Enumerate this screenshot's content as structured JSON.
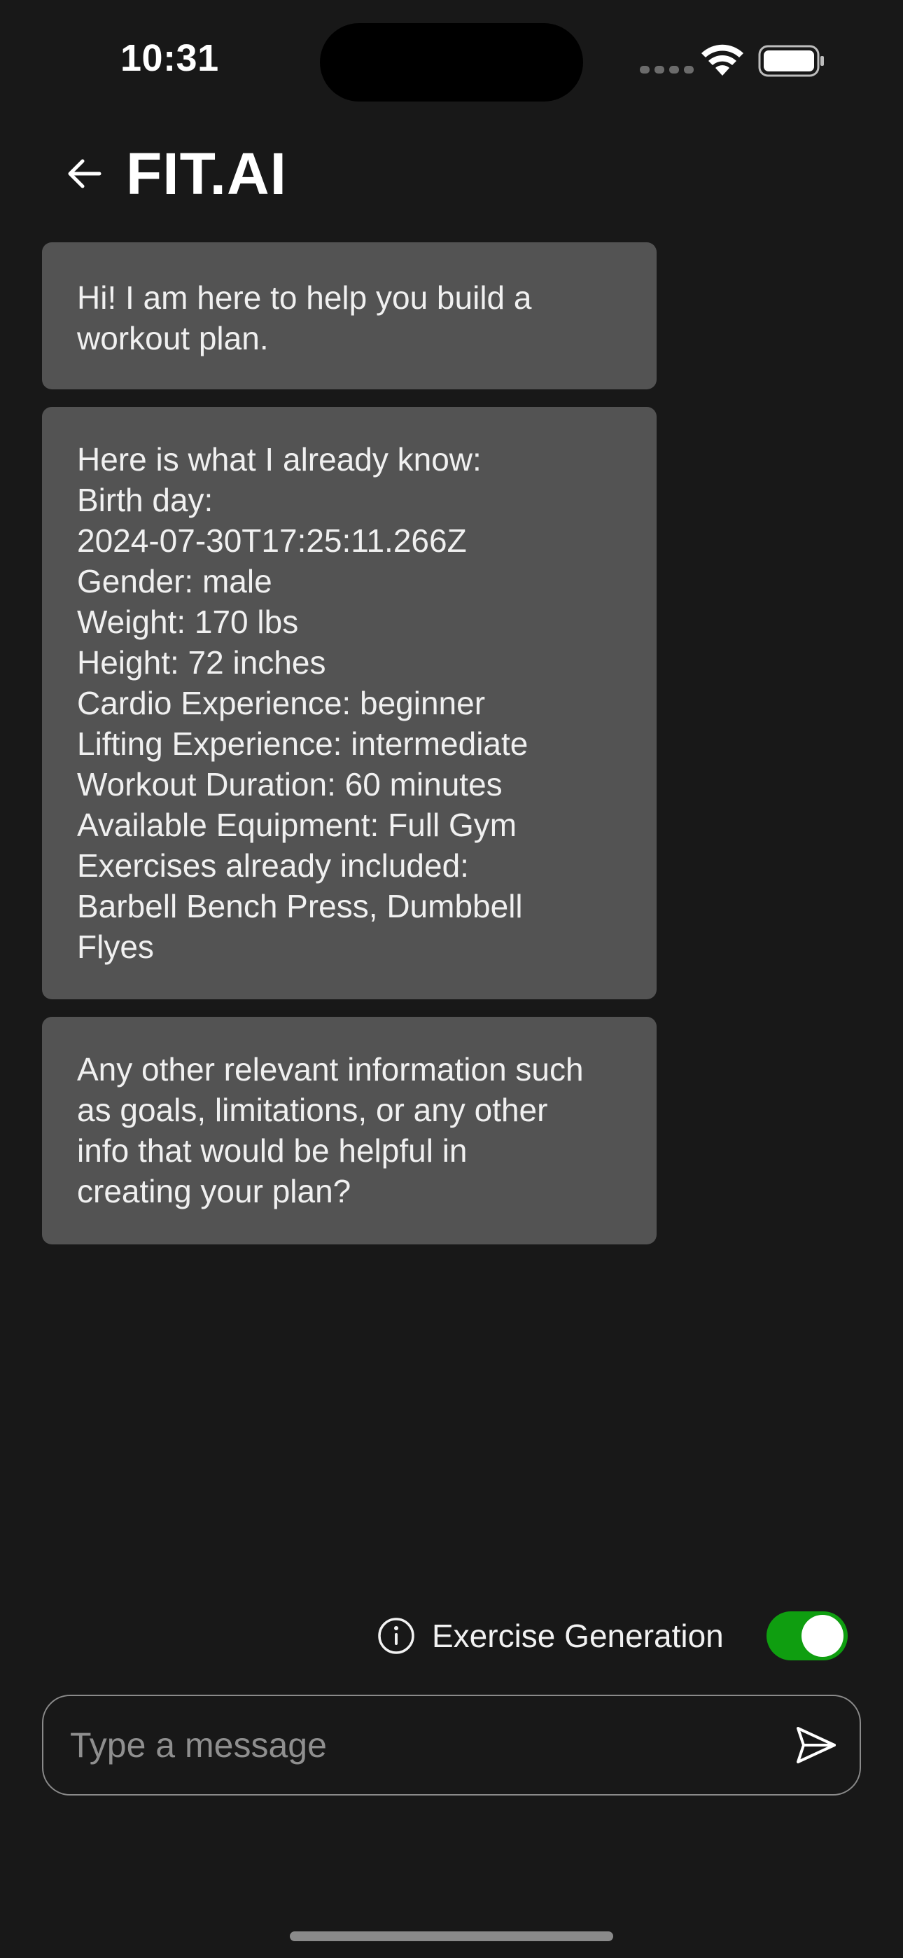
{
  "status_bar": {
    "time": "10:31"
  },
  "header": {
    "title": "FIT.AI"
  },
  "messages": [
    {
      "lines": [
        "Hi! I am here to help you build a",
        "workout plan."
      ]
    },
    {
      "lines": [
        "Here is what I already know:",
        "Birth day:",
        "2024-07-30T17:25:11.266Z",
        "Gender: male",
        "Weight: 170 lbs",
        "Height: 72 inches",
        "Cardio Experience: beginner",
        "Lifting Experience: intermediate",
        "Workout Duration: 60 minutes",
        "Available Equipment: Full Gym",
        "Exercises already included:",
        "Barbell Bench Press, Dumbbell",
        "Flyes"
      ]
    },
    {
      "lines": [
        "Any other relevant information such",
        "as goals, limitations, or any other",
        "info that would be helpful in",
        "creating your plan?"
      ]
    }
  ],
  "exercise_generation": {
    "label": "Exercise Generation",
    "enabled": true
  },
  "composer": {
    "placeholder": "Type a message",
    "value": ""
  },
  "colors": {
    "background": "#181818",
    "bubble": "#535353",
    "toggle_on": "#0f9e10"
  }
}
